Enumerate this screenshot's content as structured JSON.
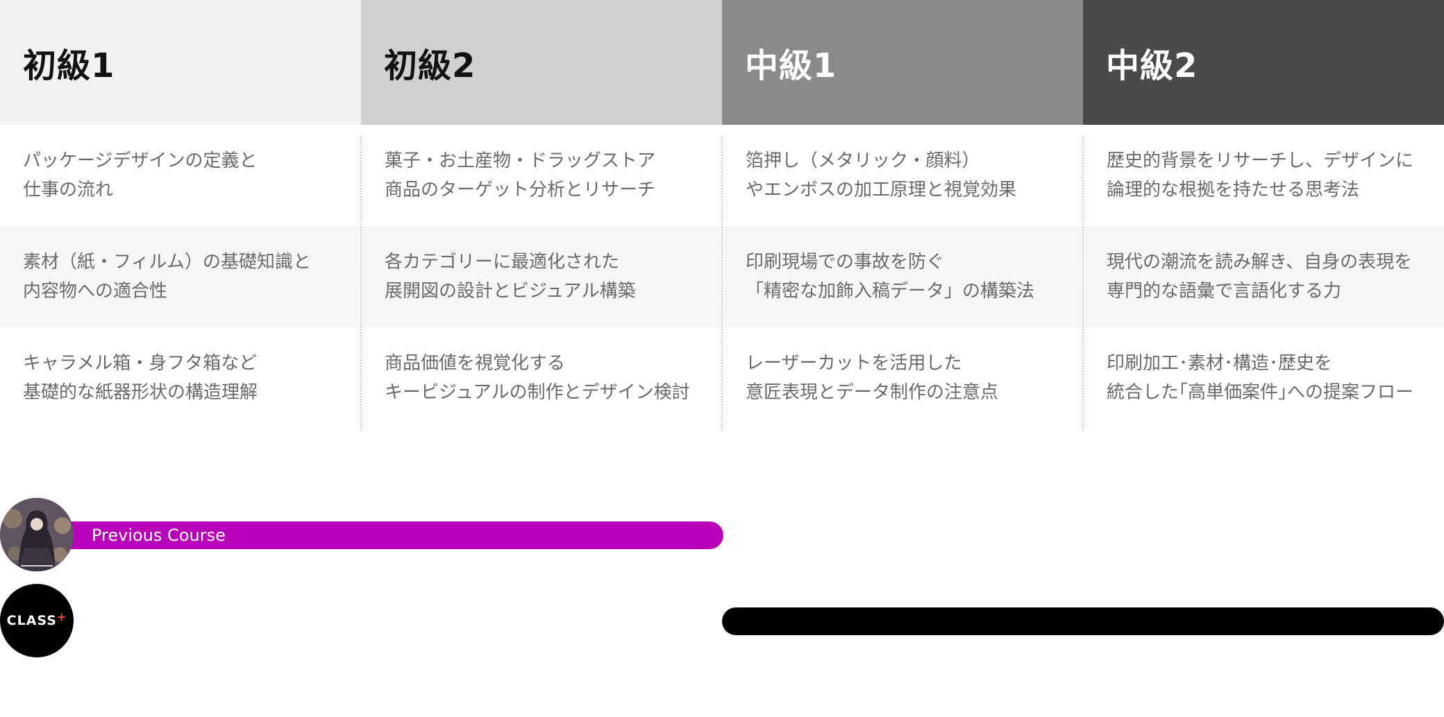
{
  "columns": [
    {
      "title": "初級1",
      "items": [
        "パッケージデザインの定義と\n仕事の流れ",
        "素材（紙・フィルム）の基礎知識と\n内容物への適合性",
        "キャラメル箱・身フタ箱など\n基礎的な紙器形状の構造理解"
      ]
    },
    {
      "title": "初級2",
      "items": [
        "菓子・お土産物・ドラッグストア\n商品のターゲット分析とリサーチ",
        "各カテゴリーに最適化された\n展開図の設計とビジュアル構築",
        "商品価値を視覚化する\nキービジュアルの制作とデザイン検討"
      ]
    },
    {
      "title": "中級1",
      "items": [
        "箔押し（メタリック・顔料）\nやエンボスの加工原理と視覚効果",
        "印刷現場での事故を防ぐ\n「精密な加飾入稿データ」の構築法",
        "レーザーカットを活用した\n意匠表現とデータ制作の注意点"
      ]
    },
    {
      "title": "中級2",
      "items": [
        "歴史的背景をリサーチし、デザインに\n論理的な根拠を持たせる思考法",
        "現代の潮流を読み解き、自身の表現を\n専門的な語彙で言語化する力",
        "印刷加工･素材･構造･歴史を\n統合した｢高単価案件｣への提案フロー"
      ]
    }
  ],
  "timeline": {
    "previous_course_label": "Previous Course",
    "logo_text": "CLASS",
    "logo_mark": "+"
  },
  "colors": {
    "previous_bar": "#b800b8",
    "class_bar": "#000000"
  }
}
